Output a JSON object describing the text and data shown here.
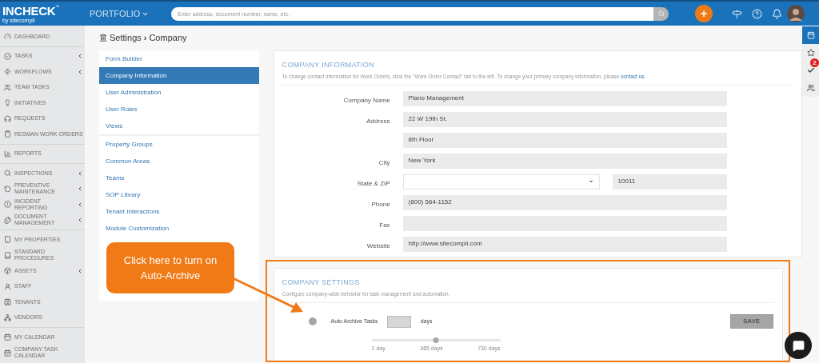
{
  "topbar": {
    "logo": "INCHECK",
    "logo_tm": "™",
    "logo_sub": "by sitecompli",
    "portfolio": "PORTFOLIO",
    "search": {
      "placeholder": "Enter address, document number, name, etc."
    },
    "add": "+"
  },
  "sidebar": {
    "groups": [
      [
        {
          "label": "DASHBOARD",
          "submenu": false
        }
      ],
      [
        {
          "label": "TASKS",
          "submenu": true
        },
        {
          "label": "WORKFLOWS",
          "submenu": true
        },
        {
          "label": "TEAM TASKS",
          "submenu": false
        },
        {
          "label": "INITIATIVES",
          "submenu": false
        },
        {
          "label": "REQUESTS",
          "submenu": false
        },
        {
          "label": "RESMAN WORK ORDERS",
          "submenu": false
        }
      ],
      [
        {
          "label": "REPORTS",
          "submenu": false
        }
      ],
      [
        {
          "label": "INSPECTIONS",
          "submenu": true
        },
        {
          "label": "PREVENTIVE MAINTENANCE",
          "submenu": true
        },
        {
          "label": "INCIDENT REPORTING",
          "submenu": true
        },
        {
          "label": "DOCUMENT MANAGEMENT",
          "submenu": true
        }
      ],
      [
        {
          "label": "MY PROPERTIES",
          "submenu": false
        },
        {
          "label": "STANDARD PROCEDURES",
          "submenu": false
        },
        {
          "label": "ASSETS",
          "submenu": true
        },
        {
          "label": "STAFF",
          "submenu": false
        },
        {
          "label": "TENANTS",
          "submenu": false
        },
        {
          "label": "VENDORS",
          "submenu": false
        }
      ],
      [
        {
          "label": "MY CALENDAR",
          "submenu": false
        },
        {
          "label": "COMPANY TASK CALENDAR",
          "submenu": false
        }
      ]
    ]
  },
  "breadcrumb": {
    "section": "Settings",
    "separator": "›",
    "page": "Company"
  },
  "settings_menu": {
    "groups": [
      [
        {
          "label": "Form Builder",
          "selected": false
        },
        {
          "label": "Company Information",
          "selected": true
        },
        {
          "label": "User Administration",
          "selected": false
        },
        {
          "label": "User Roles",
          "selected": false
        },
        {
          "label": "Views",
          "selected": false
        }
      ],
      [
        {
          "label": "Property Groups",
          "selected": false
        },
        {
          "label": "Common Areas",
          "selected": false
        },
        {
          "label": "Teams",
          "selected": false
        },
        {
          "label": "SOP Library",
          "selected": false
        },
        {
          "label": "Tenant Interactions",
          "selected": false
        },
        {
          "label": "Module Customization",
          "selected": false
        }
      ]
    ]
  },
  "company_information": {
    "title": "COMPANY INFORMATION",
    "description": "To change contact information for Work Orders, click the \"Work Order Contact\" tab to the left. To change your primary company information, please ",
    "link": "contact us",
    "description_end": ".",
    "fields": [
      {
        "kind": "text",
        "label": "Company Name",
        "value": "Plano Management"
      },
      {
        "kind": "text",
        "label": "Address",
        "value": "22 W 19th St."
      },
      {
        "kind": "text",
        "value": "8th Floor"
      },
      {
        "kind": "text",
        "label": "City",
        "value": "New York"
      },
      {
        "kind": "select_zip",
        "label": "State & ZIP",
        "value": "10011"
      },
      {
        "kind": "text",
        "label": "Phone",
        "value": "(800) 564-1152"
      },
      {
        "kind": "text",
        "label": "Fax"
      },
      {
        "kind": "text",
        "label": "Website",
        "value": "http://www.sitecompli.com"
      }
    ]
  },
  "company_settings": {
    "title": "COMPANY SETTINGS",
    "description": "Configure company-wide behavior for task management and automation.",
    "auto_archive": {
      "on": false,
      "label": "Auto Archive Tasks",
      "unit": "days"
    },
    "slider": {
      "level": 0.5,
      "labels": [
        "1 day",
        "365 days",
        "730 days"
      ]
    },
    "save": "SAVE"
  },
  "right_rail": {
    "badge": "2"
  },
  "callout": {
    "text": "Click here to turn on Auto-Archive"
  }
}
